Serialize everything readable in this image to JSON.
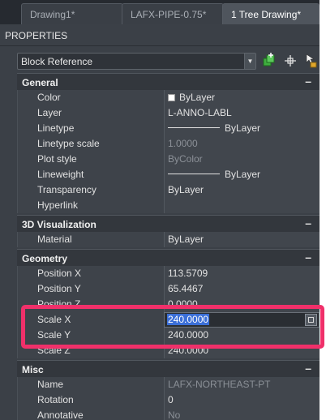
{
  "tabs": [
    {
      "label": "Drawing1*"
    },
    {
      "label": "LAFX-PIPE-0.75*"
    },
    {
      "label": "1 Tree Drawing*"
    }
  ],
  "panel_title": "PROPERTIES",
  "selector": {
    "value": "Block Reference"
  },
  "toolbar_icons": [
    "add-to-selection-icon",
    "pick-objects-icon",
    "quick-select-icon"
  ],
  "sections": {
    "general": {
      "title": "General",
      "collapse": "–",
      "rows": {
        "color": {
          "label": "Color",
          "value": "ByLayer"
        },
        "layer": {
          "label": "Layer",
          "value": "L-ANNO-LABL"
        },
        "linetype": {
          "label": "Linetype",
          "value": "ByLayer"
        },
        "linetype_scale": {
          "label": "Linetype scale",
          "value": "1.0000"
        },
        "plot_style": {
          "label": "Plot style",
          "value": "ByColor"
        },
        "lineweight": {
          "label": "Lineweight",
          "value": "ByLayer"
        },
        "transparency": {
          "label": "Transparency",
          "value": "ByLayer"
        },
        "hyperlink": {
          "label": "Hyperlink",
          "value": ""
        }
      }
    },
    "visualization": {
      "title": "3D Visualization",
      "collapse": "–",
      "rows": {
        "material": {
          "label": "Material",
          "value": "ByLayer"
        }
      }
    },
    "geometry": {
      "title": "Geometry",
      "collapse": "–",
      "rows": {
        "position_x": {
          "label": "Position X",
          "value": "113.5709"
        },
        "position_y": {
          "label": "Position Y",
          "value": "65.4467"
        },
        "position_z": {
          "label": "Position Z",
          "value": "0.0000"
        },
        "scale_x": {
          "label": "Scale X",
          "value": "240.0000"
        },
        "scale_y": {
          "label": "Scale Y",
          "value": "240.0000"
        },
        "scale_z": {
          "label": "Scale Z",
          "value": "240.0000"
        }
      }
    },
    "misc": {
      "title": "Misc",
      "collapse": "–",
      "rows": {
        "name": {
          "label": "Name",
          "value": "LAFX-NORTHEAST-PT"
        },
        "rotation": {
          "label": "Rotation",
          "value": "0"
        },
        "annotative": {
          "label": "Annotative",
          "value": "No"
        }
      }
    }
  },
  "colors": {
    "highlight": "#f0306a",
    "selection": "#3b6fd8",
    "panel_bg": "#3b4047"
  }
}
